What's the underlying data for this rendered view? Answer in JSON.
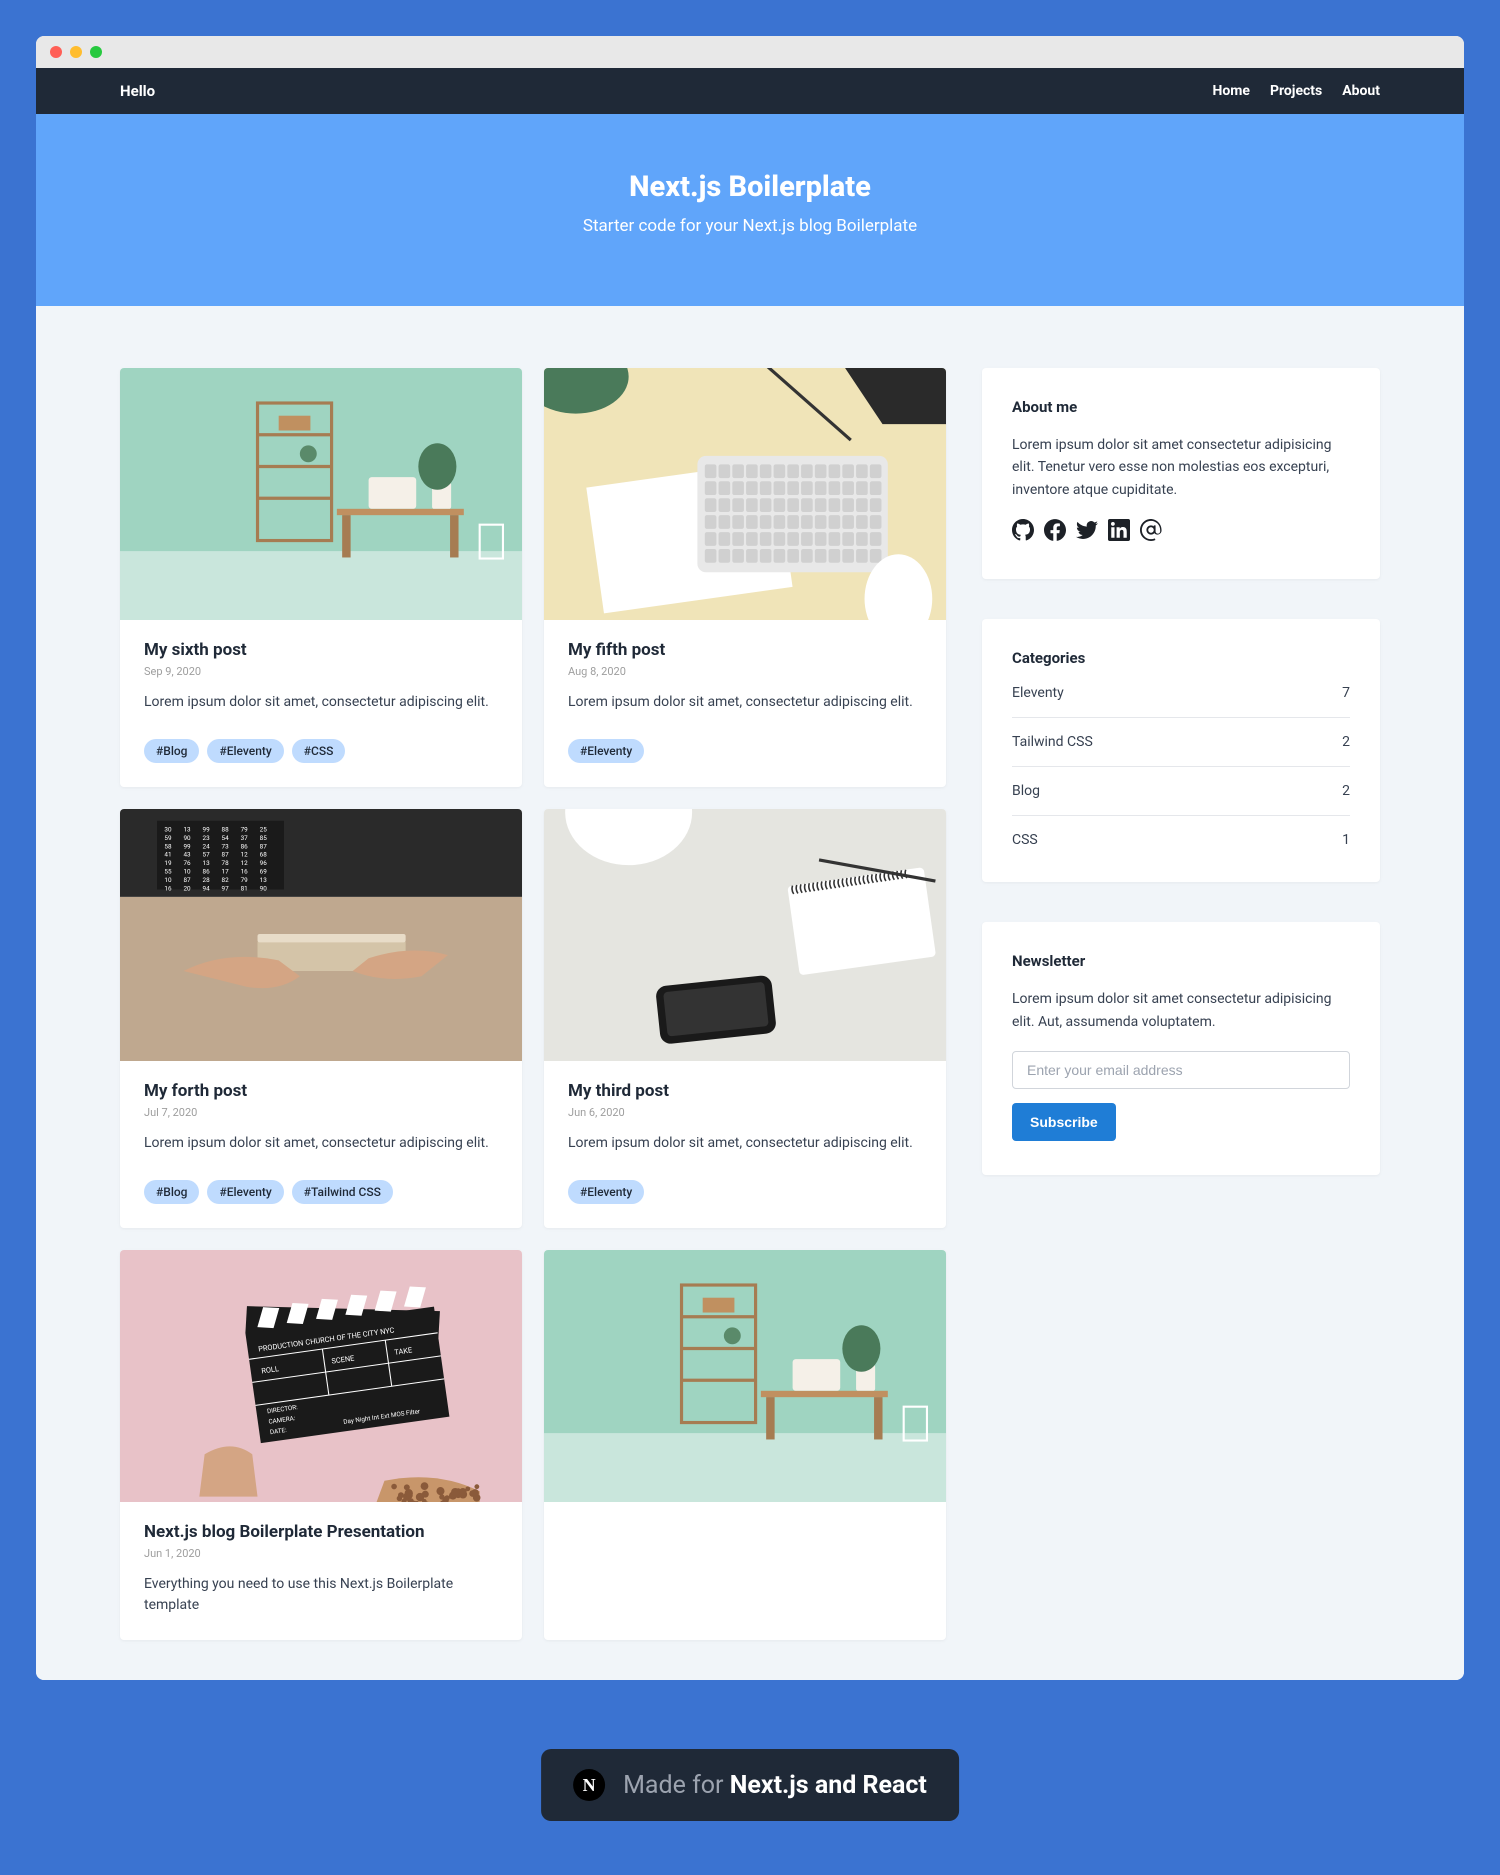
{
  "nav": {
    "brand": "Hello",
    "links": [
      {
        "label": "Home"
      },
      {
        "label": "Projects"
      },
      {
        "label": "About"
      }
    ]
  },
  "hero": {
    "title": "Next.js Boilerplate",
    "subtitle": "Starter code for your Next.js blog Boilerplate"
  },
  "posts": [
    {
      "title": "My sixth post",
      "date": "Sep 9, 2020",
      "excerpt": "Lorem ipsum dolor sit amet, consectetur adipiscing elit.",
      "tags": [
        "#Blog",
        "#Eleventy",
        "#CSS"
      ],
      "image": "desk"
    },
    {
      "title": "My fifth post",
      "date": "Aug 8, 2020",
      "excerpt": "Lorem ipsum dolor sit amet, consectetur adipiscing elit.",
      "tags": [
        "#Eleventy"
      ],
      "image": "keyboard"
    },
    {
      "title": "My forth post",
      "date": "Jul 7, 2020",
      "excerpt": "Lorem ipsum dolor sit amet, consectetur adipiscing elit.",
      "tags": [
        "#Blog",
        "#Eleventy",
        "#Tailwind CSS"
      ],
      "image": "hands"
    },
    {
      "title": "My third post",
      "date": "Jun 6, 2020",
      "excerpt": "Lorem ipsum dolor sit amet, consectetur adipiscing elit.",
      "tags": [
        "#Eleventy"
      ],
      "image": "phone"
    },
    {
      "title": "Next.js blog Boilerplate Presentation",
      "date": "Jun 1, 2020",
      "excerpt": "Everything you need to use this Next.js Boilerplate template",
      "tags": [],
      "image": "clap"
    },
    {
      "title": "",
      "date": "",
      "excerpt": "",
      "tags": [],
      "image": "desk"
    }
  ],
  "about": {
    "heading": "About me",
    "text": "Lorem ipsum dolor sit amet consectetur adipisicing elit. Tenetur vero esse non molestias eos excepturi, inventore atque cupiditate.",
    "socials": [
      "github",
      "facebook",
      "twitter",
      "linkedin",
      "email"
    ]
  },
  "categories": {
    "heading": "Categories",
    "items": [
      {
        "name": "Eleventy",
        "count": "7"
      },
      {
        "name": "Tailwind CSS",
        "count": "2"
      },
      {
        "name": "Blog",
        "count": "2"
      },
      {
        "name": "CSS",
        "count": "1"
      }
    ]
  },
  "newsletter": {
    "heading": "Newsletter",
    "text": "Lorem ipsum dolor sit amet consectetur adipisicing elit. Aut, assumenda voluptatem.",
    "placeholder": "Enter your email address",
    "button": "Subscribe"
  },
  "toast": {
    "pre": "Made for ",
    "bold": "Next.js and React"
  }
}
